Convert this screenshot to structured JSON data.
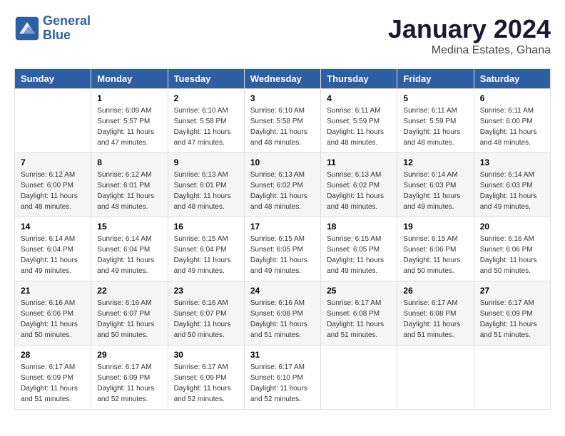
{
  "header": {
    "logo_line1": "General",
    "logo_line2": "Blue",
    "month_year": "January 2024",
    "location": "Medina Estates, Ghana"
  },
  "days_of_week": [
    "Sunday",
    "Monday",
    "Tuesday",
    "Wednesday",
    "Thursday",
    "Friday",
    "Saturday"
  ],
  "weeks": [
    [
      {
        "day": "",
        "sunrise": "",
        "sunset": "",
        "daylight": ""
      },
      {
        "day": "1",
        "sunrise": "Sunrise: 6:09 AM",
        "sunset": "Sunset: 5:57 PM",
        "daylight": "Daylight: 11 hours and 47 minutes."
      },
      {
        "day": "2",
        "sunrise": "Sunrise: 6:10 AM",
        "sunset": "Sunset: 5:58 PM",
        "daylight": "Daylight: 11 hours and 47 minutes."
      },
      {
        "day": "3",
        "sunrise": "Sunrise: 6:10 AM",
        "sunset": "Sunset: 5:58 PM",
        "daylight": "Daylight: 11 hours and 48 minutes."
      },
      {
        "day": "4",
        "sunrise": "Sunrise: 6:11 AM",
        "sunset": "Sunset: 5:59 PM",
        "daylight": "Daylight: 11 hours and 48 minutes."
      },
      {
        "day": "5",
        "sunrise": "Sunrise: 6:11 AM",
        "sunset": "Sunset: 5:59 PM",
        "daylight": "Daylight: 11 hours and 48 minutes."
      },
      {
        "day": "6",
        "sunrise": "Sunrise: 6:11 AM",
        "sunset": "Sunset: 6:00 PM",
        "daylight": "Daylight: 11 hours and 48 minutes."
      }
    ],
    [
      {
        "day": "7",
        "sunrise": "Sunrise: 6:12 AM",
        "sunset": "Sunset: 6:00 PM",
        "daylight": "Daylight: 11 hours and 48 minutes."
      },
      {
        "day": "8",
        "sunrise": "Sunrise: 6:12 AM",
        "sunset": "Sunset: 6:01 PM",
        "daylight": "Daylight: 11 hours and 48 minutes."
      },
      {
        "day": "9",
        "sunrise": "Sunrise: 6:13 AM",
        "sunset": "Sunset: 6:01 PM",
        "daylight": "Daylight: 11 hours and 48 minutes."
      },
      {
        "day": "10",
        "sunrise": "Sunrise: 6:13 AM",
        "sunset": "Sunset: 6:02 PM",
        "daylight": "Daylight: 11 hours and 48 minutes."
      },
      {
        "day": "11",
        "sunrise": "Sunrise: 6:13 AM",
        "sunset": "Sunset: 6:02 PM",
        "daylight": "Daylight: 11 hours and 48 minutes."
      },
      {
        "day": "12",
        "sunrise": "Sunrise: 6:14 AM",
        "sunset": "Sunset: 6:03 PM",
        "daylight": "Daylight: 11 hours and 49 minutes."
      },
      {
        "day": "13",
        "sunrise": "Sunrise: 6:14 AM",
        "sunset": "Sunset: 6:03 PM",
        "daylight": "Daylight: 11 hours and 49 minutes."
      }
    ],
    [
      {
        "day": "14",
        "sunrise": "Sunrise: 6:14 AM",
        "sunset": "Sunset: 6:04 PM",
        "daylight": "Daylight: 11 hours and 49 minutes."
      },
      {
        "day": "15",
        "sunrise": "Sunrise: 6:14 AM",
        "sunset": "Sunset: 6:04 PM",
        "daylight": "Daylight: 11 hours and 49 minutes."
      },
      {
        "day": "16",
        "sunrise": "Sunrise: 6:15 AM",
        "sunset": "Sunset: 6:04 PM",
        "daylight": "Daylight: 11 hours and 49 minutes."
      },
      {
        "day": "17",
        "sunrise": "Sunrise: 6:15 AM",
        "sunset": "Sunset: 6:05 PM",
        "daylight": "Daylight: 11 hours and 49 minutes."
      },
      {
        "day": "18",
        "sunrise": "Sunrise: 6:15 AM",
        "sunset": "Sunset: 6:05 PM",
        "daylight": "Daylight: 11 hours and 49 minutes."
      },
      {
        "day": "19",
        "sunrise": "Sunrise: 6:15 AM",
        "sunset": "Sunset: 6:06 PM",
        "daylight": "Daylight: 11 hours and 50 minutes."
      },
      {
        "day": "20",
        "sunrise": "Sunrise: 6:16 AM",
        "sunset": "Sunset: 6:06 PM",
        "daylight": "Daylight: 11 hours and 50 minutes."
      }
    ],
    [
      {
        "day": "21",
        "sunrise": "Sunrise: 6:16 AM",
        "sunset": "Sunset: 6:06 PM",
        "daylight": "Daylight: 11 hours and 50 minutes."
      },
      {
        "day": "22",
        "sunrise": "Sunrise: 6:16 AM",
        "sunset": "Sunset: 6:07 PM",
        "daylight": "Daylight: 11 hours and 50 minutes."
      },
      {
        "day": "23",
        "sunrise": "Sunrise: 6:16 AM",
        "sunset": "Sunset: 6:07 PM",
        "daylight": "Daylight: 11 hours and 50 minutes."
      },
      {
        "day": "24",
        "sunrise": "Sunrise: 6:16 AM",
        "sunset": "Sunset: 6:08 PM",
        "daylight": "Daylight: 11 hours and 51 minutes."
      },
      {
        "day": "25",
        "sunrise": "Sunrise: 6:17 AM",
        "sunset": "Sunset: 6:08 PM",
        "daylight": "Daylight: 11 hours and 51 minutes."
      },
      {
        "day": "26",
        "sunrise": "Sunrise: 6:17 AM",
        "sunset": "Sunset: 6:08 PM",
        "daylight": "Daylight: 11 hours and 51 minutes."
      },
      {
        "day": "27",
        "sunrise": "Sunrise: 6:17 AM",
        "sunset": "Sunset: 6:09 PM",
        "daylight": "Daylight: 11 hours and 51 minutes."
      }
    ],
    [
      {
        "day": "28",
        "sunrise": "Sunrise: 6:17 AM",
        "sunset": "Sunset: 6:09 PM",
        "daylight": "Daylight: 11 hours and 51 minutes."
      },
      {
        "day": "29",
        "sunrise": "Sunrise: 6:17 AM",
        "sunset": "Sunset: 6:09 PM",
        "daylight": "Daylight: 11 hours and 52 minutes."
      },
      {
        "day": "30",
        "sunrise": "Sunrise: 6:17 AM",
        "sunset": "Sunset: 6:09 PM",
        "daylight": "Daylight: 11 hours and 52 minutes."
      },
      {
        "day": "31",
        "sunrise": "Sunrise: 6:17 AM",
        "sunset": "Sunset: 6:10 PM",
        "daylight": "Daylight: 11 hours and 52 minutes."
      },
      {
        "day": "",
        "sunrise": "",
        "sunset": "",
        "daylight": ""
      },
      {
        "day": "",
        "sunrise": "",
        "sunset": "",
        "daylight": ""
      },
      {
        "day": "",
        "sunrise": "",
        "sunset": "",
        "daylight": ""
      }
    ]
  ]
}
